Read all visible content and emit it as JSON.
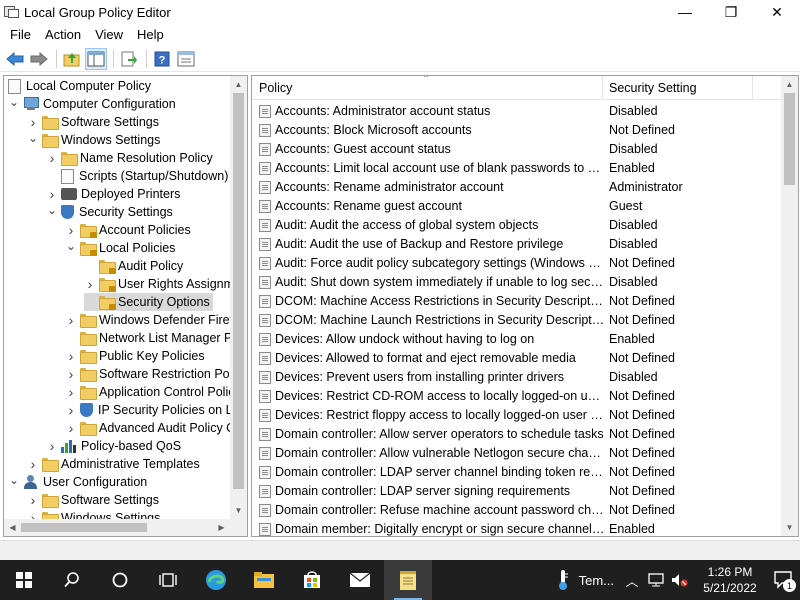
{
  "window": {
    "title": "Local Group Policy Editor",
    "minimize": "—",
    "maximize": "❐",
    "close": "✕"
  },
  "menu": [
    "File",
    "Action",
    "View",
    "Help"
  ],
  "toolbar": {
    "icons": [
      "back-arrow-icon",
      "forward-arrow-icon",
      "up-folder-icon",
      "show-hide-tree-icon",
      "export-list-icon",
      "help-icon",
      "properties-icon"
    ]
  },
  "tree": {
    "root": "Local Computer Policy",
    "items": [
      {
        "label": "Computer Configuration",
        "level": 1,
        "expander": "expanded",
        "icon": "computer"
      },
      {
        "label": "Software Settings",
        "level": 2,
        "expander": "collapsed",
        "icon": "folder"
      },
      {
        "label": "Windows Settings",
        "level": 2,
        "expander": "expanded",
        "icon": "folder"
      },
      {
        "label": "Name Resolution Policy",
        "level": 3,
        "expander": "collapsed",
        "icon": "folder"
      },
      {
        "label": "Scripts (Startup/Shutdown)",
        "level": 3,
        "expander": "none",
        "icon": "doc"
      },
      {
        "label": "Deployed Printers",
        "level": 3,
        "expander": "collapsed",
        "icon": "printer"
      },
      {
        "label": "Security Settings",
        "level": 3,
        "expander": "expanded",
        "icon": "shield"
      },
      {
        "label": "Account Policies",
        "level": 4,
        "expander": "collapsed",
        "icon": "lockfolder"
      },
      {
        "label": "Local Policies",
        "level": 4,
        "expander": "expanded",
        "icon": "lockfolder"
      },
      {
        "label": "Audit Policy",
        "level": 5,
        "expander": "none",
        "icon": "lockfolder"
      },
      {
        "label": "User Rights Assignment",
        "level": 5,
        "expander": "collapsed",
        "icon": "lockfolder"
      },
      {
        "label": "Security Options",
        "level": 5,
        "expander": "none",
        "icon": "lockfolder",
        "selected": true
      },
      {
        "label": "Windows Defender Firewall",
        "level": 4,
        "expander": "collapsed",
        "icon": "folder"
      },
      {
        "label": "Network List Manager Policies",
        "level": 4,
        "expander": "none",
        "icon": "folder"
      },
      {
        "label": "Public Key Policies",
        "level": 4,
        "expander": "collapsed",
        "icon": "folder"
      },
      {
        "label": "Software Restriction Policies",
        "level": 4,
        "expander": "collapsed",
        "icon": "folder"
      },
      {
        "label": "Application Control Policies",
        "level": 4,
        "expander": "collapsed",
        "icon": "folder"
      },
      {
        "label": "IP Security Policies on Local Computer",
        "level": 4,
        "expander": "collapsed",
        "icon": "shield"
      },
      {
        "label": "Advanced Audit Policy Configuration",
        "level": 4,
        "expander": "collapsed",
        "icon": "folder"
      },
      {
        "label": "Policy-based QoS",
        "level": 3,
        "expander": "collapsed",
        "icon": "bars"
      },
      {
        "label": "Administrative Templates",
        "level": 2,
        "expander": "collapsed",
        "icon": "folder"
      },
      {
        "label": "User Configuration",
        "level": 1,
        "expander": "expanded",
        "icon": "user"
      },
      {
        "label": "Software Settings",
        "level": 2,
        "expander": "collapsed",
        "icon": "folder"
      },
      {
        "label": "Windows Settings",
        "level": 2,
        "expander": "collapsed",
        "icon": "folder"
      }
    ]
  },
  "list": {
    "columns": {
      "policy": "Policy",
      "setting": "Security Setting"
    },
    "rows": [
      {
        "policy": "Accounts: Administrator account status",
        "setting": "Disabled"
      },
      {
        "policy": "Accounts: Block Microsoft accounts",
        "setting": "Not Defined"
      },
      {
        "policy": "Accounts: Guest account status",
        "setting": "Disabled"
      },
      {
        "policy": "Accounts: Limit local account use of blank passwords to co...",
        "setting": "Enabled"
      },
      {
        "policy": "Accounts: Rename administrator account",
        "setting": "Administrator"
      },
      {
        "policy": "Accounts: Rename guest account",
        "setting": "Guest"
      },
      {
        "policy": "Audit: Audit the access of global system objects",
        "setting": "Disabled"
      },
      {
        "policy": "Audit: Audit the use of Backup and Restore privilege",
        "setting": "Disabled"
      },
      {
        "policy": "Audit: Force audit policy subcategory settings (Windows Vis...",
        "setting": "Not Defined"
      },
      {
        "policy": "Audit: Shut down system immediately if unable to log secur...",
        "setting": "Disabled"
      },
      {
        "policy": "DCOM: Machine Access Restrictions in Security Descriptor D...",
        "setting": "Not Defined"
      },
      {
        "policy": "DCOM: Machine Launch Restrictions in Security Descriptor ...",
        "setting": "Not Defined"
      },
      {
        "policy": "Devices: Allow undock without having to log on",
        "setting": "Enabled"
      },
      {
        "policy": "Devices: Allowed to format and eject removable media",
        "setting": "Not Defined"
      },
      {
        "policy": "Devices: Prevent users from installing printer drivers",
        "setting": "Disabled"
      },
      {
        "policy": "Devices: Restrict CD-ROM access to locally logged-on user ...",
        "setting": "Not Defined"
      },
      {
        "policy": "Devices: Restrict floppy access to locally logged-on user only",
        "setting": "Not Defined"
      },
      {
        "policy": "Domain controller: Allow server operators to schedule tasks",
        "setting": "Not Defined"
      },
      {
        "policy": "Domain controller: Allow vulnerable Netlogon secure chann...",
        "setting": "Not Defined"
      },
      {
        "policy": "Domain controller: LDAP server channel binding token requi...",
        "setting": "Not Defined"
      },
      {
        "policy": "Domain controller: LDAP server signing requirements",
        "setting": "Not Defined"
      },
      {
        "policy": "Domain controller: Refuse machine account password chan...",
        "setting": "Not Defined"
      },
      {
        "policy": "Domain member: Digitally encrypt or sign secure channel d...",
        "setting": "Enabled"
      }
    ]
  },
  "taskbar": {
    "apps": [
      "start-icon",
      "search-icon",
      "cortana-icon",
      "task-view-icon",
      "edge-icon",
      "file-explorer-icon",
      "store-icon",
      "mail-icon",
      "notepad-icon"
    ],
    "weather": "Tem...",
    "time": "1:26 PM",
    "date": "5/21/2022",
    "notifications": "1"
  },
  "colors": {
    "accent": "#0078d7",
    "taskbar": "#1f1f1f",
    "selection": "#d9d9d9",
    "folder": "#f2cd63"
  }
}
